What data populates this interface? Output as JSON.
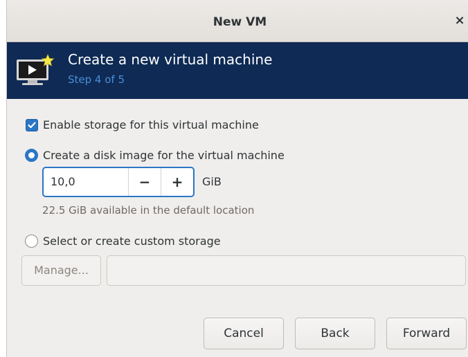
{
  "window": {
    "title": "New VM",
    "close_glyph": "×"
  },
  "header": {
    "title": "Create a new virtual machine",
    "step": "Step 4 of 5",
    "icon": "vm-display-icon",
    "background": "#0e2a55",
    "step_color": "#4a8fd6"
  },
  "storage": {
    "enable_label": "Enable storage for this virtual machine",
    "enable_checked": true,
    "disk_image_label": "Create a disk image for the virtual machine",
    "disk_image_selected": true,
    "size_value": "10,0",
    "decrement_glyph": "−",
    "increment_glyph": "+",
    "size_unit": "GiB",
    "available_text": "22.5 GiB available in the default location",
    "custom_label": "Select or create custom storage",
    "custom_selected": false,
    "manage_label": "Manage...",
    "custom_path_value": ""
  },
  "footer": {
    "cancel_label": "Cancel",
    "back_label": "Back",
    "forward_label": "Forward"
  },
  "colors": {
    "accent": "#2a76c6",
    "window_bg": "#f0eeec"
  }
}
